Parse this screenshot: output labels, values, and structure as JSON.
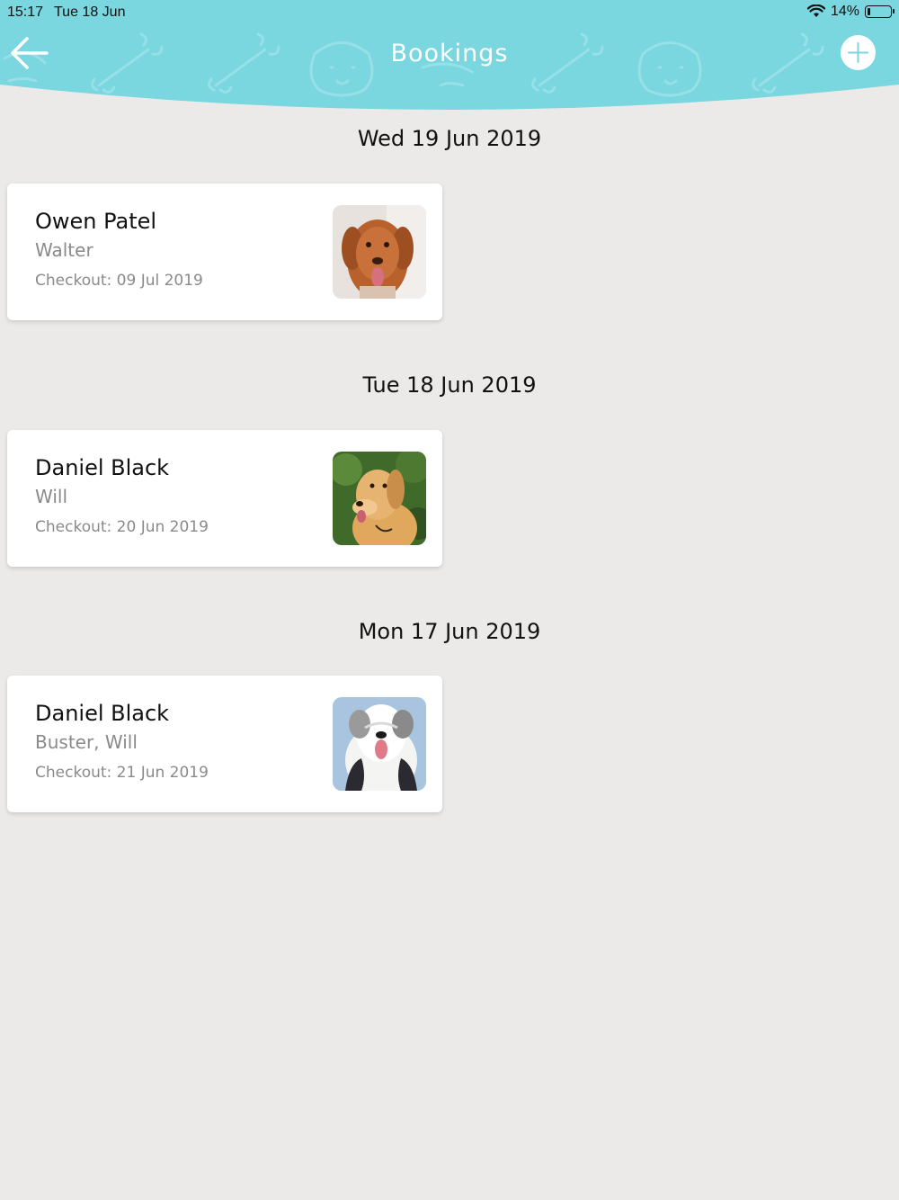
{
  "status_bar": {
    "time": "15:17",
    "date": "Tue 18 Jun",
    "battery": "14%",
    "battery_level": 0.14
  },
  "header": {
    "title": "Bookings",
    "back_icon": "arrow-left-icon",
    "add_icon": "plus-circle-icon",
    "background_color": "#7ad6df"
  },
  "bookings": [
    {
      "date": "Wed 19 Jun 2019",
      "owner": "Owen Patel",
      "pets": "Walter",
      "checkout": "Checkout: 09 Jul 2019",
      "photo": "brown-retriever-dog-photo"
    },
    {
      "date": "Tue 18 Jun 2019",
      "owner": "Daniel Black",
      "pets": "Will",
      "checkout": "Checkout: 20 Jun 2019",
      "photo": "golden-retriever-dog-photo"
    },
    {
      "date": "Mon 17 Jun 2019",
      "owner": "Daniel Black",
      "pets": "Buster, Will",
      "checkout": "Checkout: 21 Jun 2019",
      "photo": "sheepdog-photo"
    }
  ]
}
